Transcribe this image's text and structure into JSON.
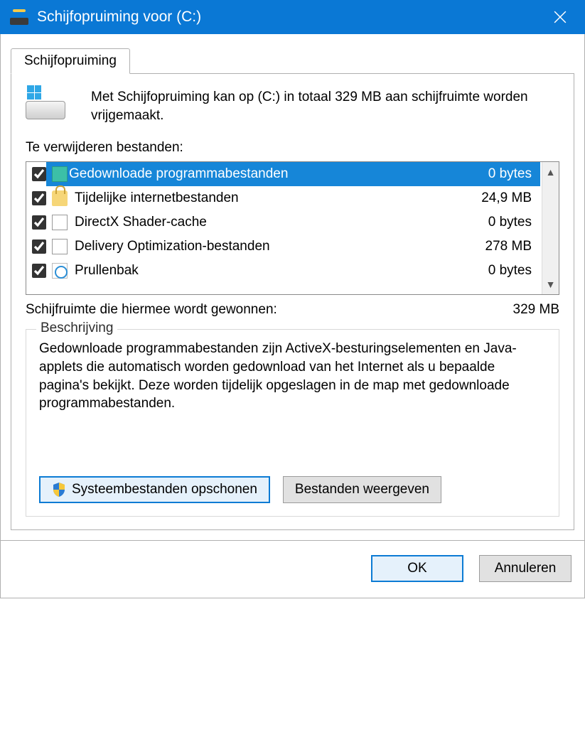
{
  "titlebar": {
    "title": "Schijfopruiming voor  (C:)"
  },
  "tab": {
    "label": "Schijfopruiming"
  },
  "intro": "Met Schijfopruiming kan op  (C:) in totaal 329 MB aan schijfruimte worden vrijgemaakt.",
  "files_label": "Te verwijderen bestanden:",
  "files": [
    {
      "checked": true,
      "icon": "folder",
      "name": "Gedownloade programmabestanden",
      "size": "0 bytes",
      "selected": true
    },
    {
      "checked": true,
      "icon": "lock",
      "name": "Tijdelijke internetbestanden",
      "size": "24,9 MB",
      "selected": false
    },
    {
      "checked": true,
      "icon": "file",
      "name": "DirectX Shader-cache",
      "size": "0 bytes",
      "selected": false
    },
    {
      "checked": true,
      "icon": "file",
      "name": "Delivery Optimization-bestanden",
      "size": "278 MB",
      "selected": false
    },
    {
      "checked": true,
      "icon": "recycle",
      "name": "Prullenbak",
      "size": "0 bytes",
      "selected": false
    }
  ],
  "total": {
    "label": "Schijfruimte die hiermee wordt gewonnen:",
    "value": "329 MB"
  },
  "description": {
    "legend": "Beschrijving",
    "text": "Gedownloade programmabestanden zijn ActiveX-besturingselementen en Java-applets die automatisch worden gedownload van het Internet als u bepaalde pagina's bekijkt. Deze worden tijdelijk opgeslagen in de map met gedownloade programmabestanden."
  },
  "buttons": {
    "clean_system": "Systeembestanden opschonen",
    "view_files": "Bestanden weergeven",
    "ok": "OK",
    "cancel": "Annuleren"
  }
}
